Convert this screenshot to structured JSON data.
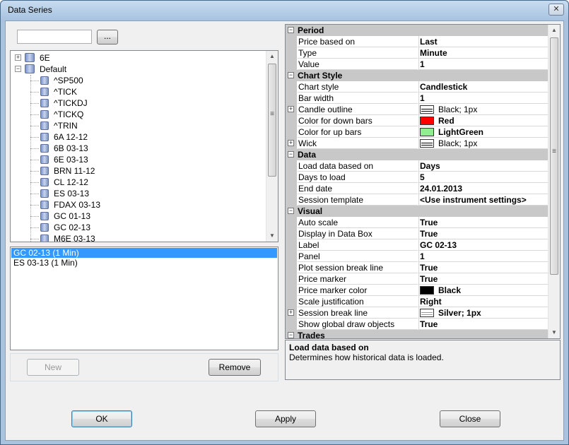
{
  "window": {
    "title": "Data Series",
    "close_glyph": "✕"
  },
  "search": {
    "value": "",
    "browse_label": "..."
  },
  "tree": {
    "root_items": [
      {
        "label": "6E",
        "expander": "+"
      },
      {
        "label": "Default",
        "expander": "−"
      }
    ],
    "children": [
      "^SP500",
      "^TICK",
      "^TICKDJ",
      "^TICKQ",
      "^TRIN",
      "6A 12-12",
      "6B 03-13",
      "6E 03-13",
      "BRN 11-12",
      "CL 12-12",
      "ES 03-13",
      "FDAX 03-13",
      "GC 01-13",
      "GC 02-13",
      "M6E 03-13"
    ]
  },
  "series_list": {
    "items": [
      "GC 02-13 (1 Min)",
      "ES 03-13 (1 Min)"
    ],
    "selected_index": 0
  },
  "buttons": {
    "new": "New",
    "remove": "Remove",
    "ok": "OK",
    "apply": "Apply",
    "close": "Close"
  },
  "property_grid": {
    "rows": [
      {
        "type": "cat",
        "name": "Period",
        "expander": "−"
      },
      {
        "type": "prop",
        "name": "Price based on",
        "value": "Last"
      },
      {
        "type": "prop",
        "name": "Type",
        "value": "Minute"
      },
      {
        "type": "prop",
        "name": "Value",
        "value": "1"
      },
      {
        "type": "cat",
        "name": "Chart Style",
        "expander": "−"
      },
      {
        "type": "prop",
        "name": "Chart style",
        "value": "Candlestick"
      },
      {
        "type": "prop",
        "name": "Bar width",
        "value": "1"
      },
      {
        "type": "prop",
        "name": "Candle outline",
        "value": "Black; 1px",
        "expander": "+",
        "swatch": "line",
        "normal": true
      },
      {
        "type": "prop",
        "name": "Color for down bars",
        "value": "Red",
        "swatch": "#ff0000"
      },
      {
        "type": "prop",
        "name": "Color for up bars",
        "value": "LightGreen",
        "swatch": "#90ee90"
      },
      {
        "type": "prop",
        "name": "Wick",
        "value": "Black; 1px",
        "expander": "+",
        "swatch": "line",
        "normal": true
      },
      {
        "type": "cat",
        "name": "Data",
        "expander": "−"
      },
      {
        "type": "prop",
        "name": "Load data based on",
        "value": "Days"
      },
      {
        "type": "prop",
        "name": "Days to load",
        "value": "5"
      },
      {
        "type": "prop",
        "name": "End date",
        "value": "24.01.2013"
      },
      {
        "type": "prop",
        "name": "Session template",
        "value": "<Use instrument settings>"
      },
      {
        "type": "cat",
        "name": "Visual",
        "expander": "−"
      },
      {
        "type": "prop",
        "name": "Auto scale",
        "value": "True"
      },
      {
        "type": "prop",
        "name": "Display in Data Box",
        "value": "True"
      },
      {
        "type": "prop",
        "name": "Label",
        "value": "GC 02-13"
      },
      {
        "type": "prop",
        "name": "Panel",
        "value": "1"
      },
      {
        "type": "prop",
        "name": "Plot session break line",
        "value": "True"
      },
      {
        "type": "prop",
        "name": "Price marker",
        "value": "True"
      },
      {
        "type": "prop",
        "name": "Price marker color",
        "value": "Black",
        "swatch": "#000000"
      },
      {
        "type": "prop",
        "name": "Scale justification",
        "value": "Right"
      },
      {
        "type": "prop",
        "name": "Session break line",
        "value": "Silver; 1px",
        "expander": "+",
        "swatch": "line-silver"
      },
      {
        "type": "prop",
        "name": "Show global draw objects",
        "value": "True"
      },
      {
        "type": "cat",
        "name": "Trades",
        "expander": "−"
      }
    ]
  },
  "help": {
    "title": "Load data based on",
    "description": "Determines how historical data is loaded."
  },
  "scroll": {
    "up_glyph": "▲",
    "down_glyph": "▼",
    "grip_glyph": "≡"
  }
}
